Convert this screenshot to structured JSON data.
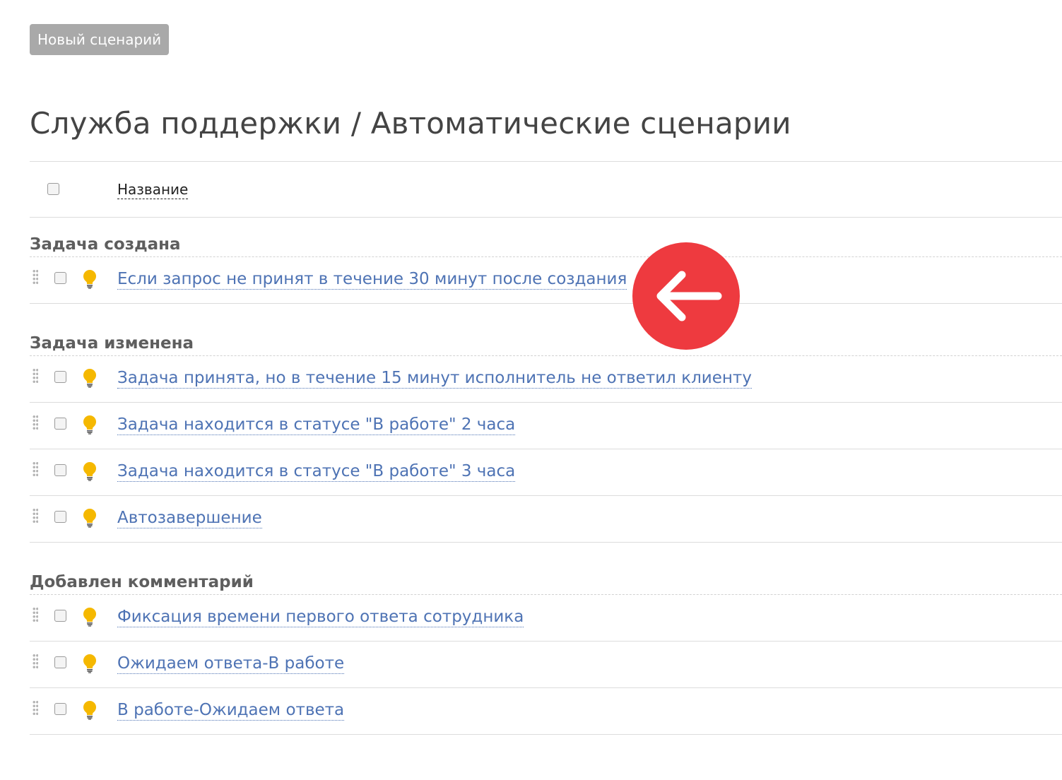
{
  "toolbar": {
    "new_scenario_label": "Новый сценарий"
  },
  "page": {
    "title": "Служба поддержки / Автоматические сценарии"
  },
  "table": {
    "name_column": "Название"
  },
  "groups": [
    {
      "title": "Задача создана",
      "rows": [
        {
          "label": "Если запрос не принят в течение 30 минут после создания",
          "icon": "lightbulb-icon"
        }
      ]
    },
    {
      "title": "Задача изменена",
      "rows": [
        {
          "label": "Задача принята, но в течение 15 минут исполнитель не ответил клиенту",
          "icon": "lightbulb-icon"
        },
        {
          "label": "Задача находится в статусе \"В работе\" 2 часа",
          "icon": "lightbulb-icon"
        },
        {
          "label": "Задача находится в статусе \"В работе\" 3 часа",
          "icon": "lightbulb-icon"
        },
        {
          "label": "Автозавершение",
          "icon": "lightbulb-icon"
        }
      ]
    },
    {
      "title": "Добавлен комментарий",
      "rows": [
        {
          "label": "Фиксация времени первого ответа сотрудника",
          "icon": "lightbulb-icon"
        },
        {
          "label": "Ожидаем ответа-В работе",
          "icon": "lightbulb-icon"
        },
        {
          "label": "В работе-Ожидаем ответа",
          "icon": "lightbulb-icon"
        }
      ]
    }
  ],
  "overlay": {
    "icon": "arrow-left-icon",
    "color": "#ee3a3f"
  },
  "colors": {
    "link": "#4e73b4",
    "bulb": "#f5b800",
    "button": "#a9a9a9"
  }
}
